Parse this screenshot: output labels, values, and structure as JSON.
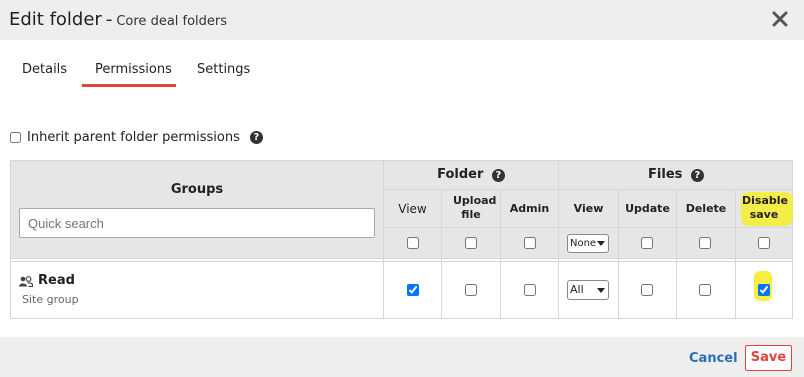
{
  "dialog": {
    "title": "Edit folder",
    "separator": "-",
    "subtitle": "Core deal folders",
    "close_icon": "close-icon"
  },
  "tabs": [
    {
      "label": "Details",
      "active": false
    },
    {
      "label": "Permissions",
      "active": true
    },
    {
      "label": "Settings",
      "active": false
    }
  ],
  "inherit": {
    "label": "Inherit parent folder permissions",
    "checked": false
  },
  "grid": {
    "groups_header": "Groups",
    "search_placeholder": "Quick search",
    "folder_header": "Folder",
    "files_header": "Files",
    "columns": {
      "folder_view": "View",
      "upload_file": "Upload file",
      "admin": "Admin",
      "files_view": "View",
      "update": "Update",
      "delete": "Delete",
      "disable_save": "Disable save"
    },
    "header_row": {
      "files_view_select": "None"
    },
    "rows": [
      {
        "name": "Read",
        "type": "Site group",
        "folder_view": true,
        "upload_file": false,
        "admin": false,
        "files_view_select": "All",
        "update": false,
        "delete": false,
        "disable_save": true
      }
    ],
    "highlight_color": "#f6ec2a"
  },
  "footer": {
    "cancel_label": "Cancel",
    "save_label": "Save"
  },
  "colors": {
    "accent": "#e0453c",
    "link": "#2a6fb5",
    "header_bg": "#eeeeee",
    "grid_header_bg": "#e6e6e6"
  }
}
